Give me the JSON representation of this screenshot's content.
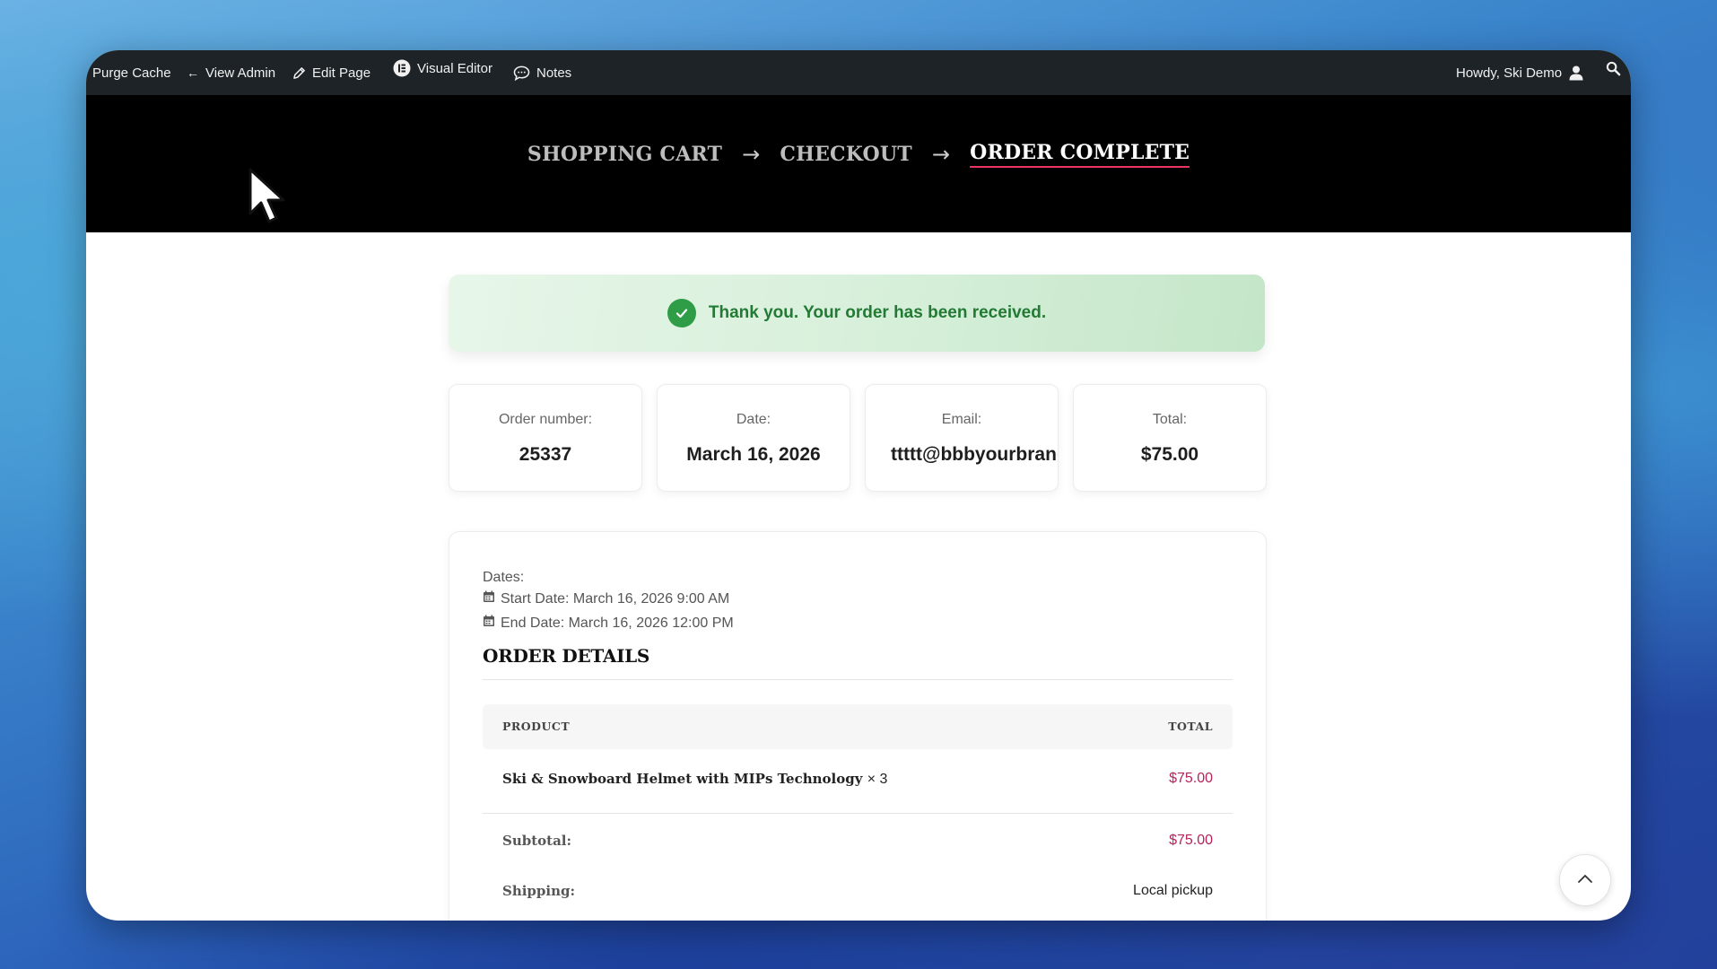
{
  "admin_bar": {
    "purge_cache": "Purge Cache",
    "view_admin": "View Admin",
    "edit_page": "Edit Page",
    "visual_editor": "Visual Editor",
    "notes": "Notes",
    "howdy": "Howdy, Ski Demo"
  },
  "steps": {
    "cart": "SHOPPING CART",
    "checkout": "CHECKOUT",
    "complete": "ORDER COMPLETE",
    "arrow": "→"
  },
  "notice": {
    "message": "Thank you. Your order has been received."
  },
  "summary": {
    "order_number_label": "Order number:",
    "order_number": "25337",
    "date_label": "Date:",
    "date": "March 16, 2026",
    "email_label": "Email:",
    "email": "ttttt@bbbyourbrandb",
    "total_label": "Total:",
    "total": "$75.00"
  },
  "details": {
    "dates_label": "Dates:",
    "start_date": "Start Date: March 16, 2026 9:00 AM",
    "end_date": "End Date: March 16, 2026 12:00 PM",
    "title": "ORDER DETAILS",
    "col_product": "PRODUCT",
    "col_total": "TOTAL",
    "item_name": "Ski & Snowboard Helmet with MIPs Technology",
    "item_qty": "× 3",
    "item_total": "$75.00",
    "subtotal_label": "Subtotal:",
    "subtotal": "$75.00",
    "shipping_label": "Shipping:",
    "shipping": "Local pickup"
  },
  "colors": {
    "admin_bar_bg": "#1d2327",
    "hero_bg": "#000000",
    "active_underline": "#e8355f",
    "notice_text": "#237a35",
    "price": "#b5235a"
  }
}
